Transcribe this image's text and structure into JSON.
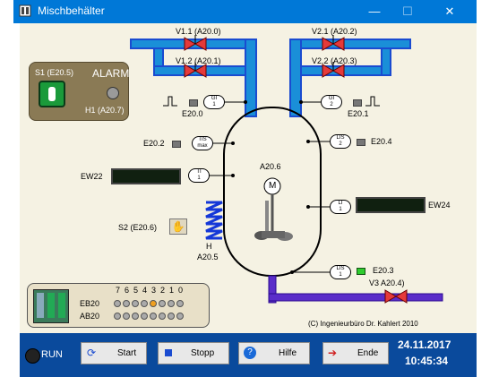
{
  "window": {
    "title": "Mischbehälter",
    "min_glyph": "—",
    "max_glyph": "☐",
    "close_glyph": "✕"
  },
  "valves": {
    "v11": "V1.1 (A20.0)",
    "v12": "V1.2 (A20.1)",
    "v21": "V2.1 (A20.2)",
    "v22": "V2.2 (A20.3)",
    "v3": "V3 A20.4)"
  },
  "alarm_panel": {
    "s1": "S1 (E20.5)",
    "alarm": "ALARM",
    "h1": "H1 (A20.7)"
  },
  "sensors": {
    "gi1": {
      "top": "GI",
      "bottom": "1",
      "label": "E20.0"
    },
    "gi2": {
      "top": "GI",
      "bottom": "2",
      "label": "E20.1"
    },
    "tis": {
      "top": "TIS",
      "bottom": "max",
      "label": "E20.2"
    },
    "ti": {
      "top": "TI",
      "bottom": "1"
    },
    "lis2": {
      "top": "LIS",
      "bottom": "2",
      "label": "E20.4"
    },
    "li1": {
      "top": "LI",
      "bottom": "1"
    },
    "lis1": {
      "top": "LIS",
      "bottom": "1",
      "label": "E20.3"
    }
  },
  "displays": {
    "ew22": "EW22",
    "ew24": "EW24"
  },
  "mixer": {
    "label": "A20.6",
    "symbol": "M"
  },
  "heater": {
    "s2": "S2 (E20.6)",
    "h": "H",
    "label": "A20.5"
  },
  "io_panel": {
    "bits": [
      "7",
      "6",
      "5",
      "4",
      "3",
      "2",
      "1",
      "0"
    ],
    "eb20": "EB20",
    "ab20": "AB20"
  },
  "copyright": "(C) Ingenieurbüro Dr. Kahlert 2010",
  "bottom": {
    "run": "RUN",
    "buttons": {
      "start": "Start",
      "stop": "Stopp",
      "help": "Hilfe",
      "end": "Ende"
    },
    "date": "24.11.2017",
    "time": "10:45:34"
  }
}
